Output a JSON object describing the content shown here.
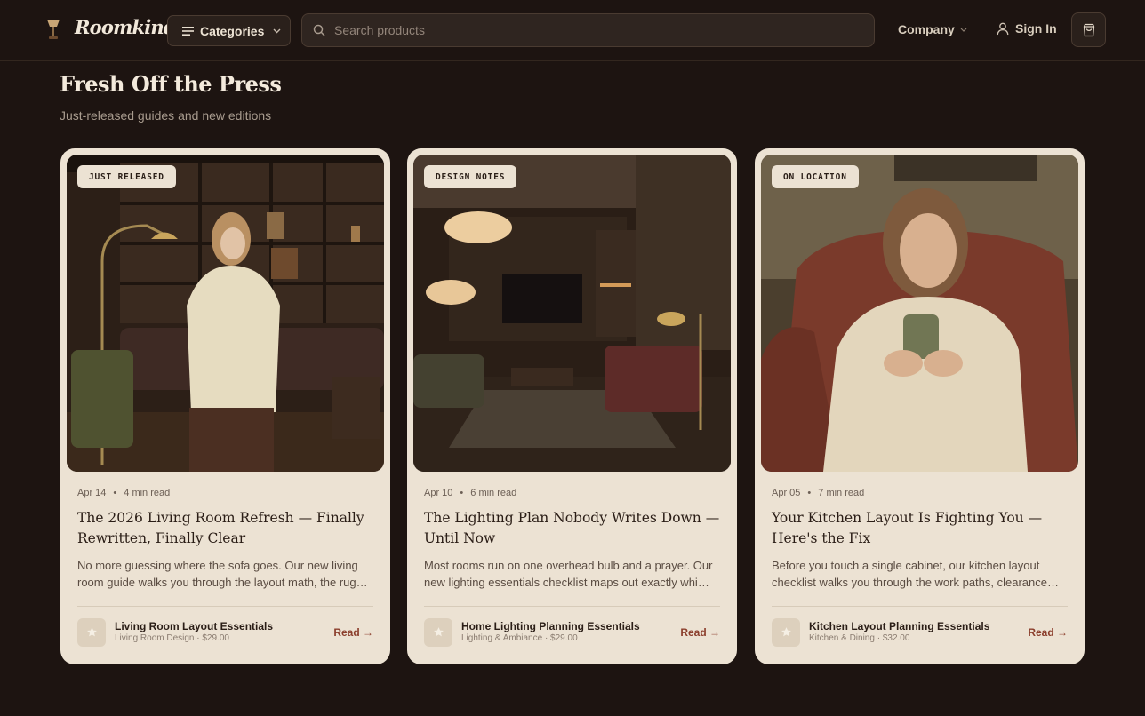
{
  "header": {
    "brand": "Roomkindle",
    "categories_label": "Categories",
    "search_placeholder": "Search products",
    "company_label": "Company",
    "signin_label": "Sign In"
  },
  "section": {
    "title": "Fresh Off the Press",
    "subtitle": "Just-released guides and new editions"
  },
  "cards": [
    {
      "tag": "JUST RELEASED",
      "date": "Apr 14",
      "read_time": "4 min read",
      "title": "The 2026 Living Room Refresh — Finally Rewritten, Finally Clear",
      "excerpt": "No more guessing where the sofa goes. Our new living room guide walks you through the layout math, the rug sizing and the furniture spacing.",
      "product_name": "Living Room Layout Essentials",
      "product_meta": "Living Room Design · $29.00",
      "read_label": "Read →"
    },
    {
      "tag": "DESIGN NOTES",
      "date": "Apr 10",
      "read_time": "6 min read",
      "title": "The Lighting Plan Nobody Writes Down — Until Now",
      "excerpt": "Most rooms run on one overhead bulb and a prayer. Our new lighting essentials checklist maps out exactly which layers every room needs.",
      "product_name": "Home Lighting Planning Essentials",
      "product_meta": "Lighting & Ambiance · $29.00",
      "read_label": "Read →"
    },
    {
      "tag": "ON LOCATION",
      "date": "Apr 05",
      "read_time": "7 min read",
      "title": "Your Kitchen Layout Is Fighting You — Here's the Fix",
      "excerpt": "Before you touch a single cabinet, our kitchen layout checklist walks you through the work paths, clearances and storage zones.",
      "product_name": "Kitchen Layout Planning Essentials",
      "product_meta": "Kitchen & Dining · $32.00",
      "read_label": "Read →"
    }
  ],
  "colors": {
    "background": "#1d1411",
    "card": "#ece2d3",
    "accent": "#8b3e2c"
  }
}
